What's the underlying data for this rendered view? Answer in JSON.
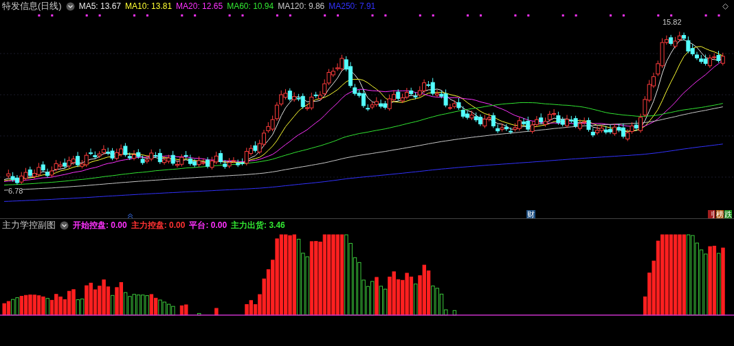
{
  "main_panel": {
    "title": "特发信息(日线)",
    "legend": [
      {
        "label": "MA5:",
        "value": "13.67",
        "color": "#e8e8e8"
      },
      {
        "label": "MA10:",
        "value": "13.81",
        "color": "#ffff32"
      },
      {
        "label": "MA20:",
        "value": "12.65",
        "color": "#ff32ff"
      },
      {
        "label": "MA60:",
        "value": "10.94",
        "color": "#32e632"
      },
      {
        "label": "MA120:",
        "value": "9.86",
        "color": "#c8c8c8"
      },
      {
        "label": "MA250:",
        "value": "7.91",
        "color": "#3232ff"
      }
    ],
    "high_label": "15.82",
    "low_label": "6.78",
    "markers": [
      {
        "text": "财",
        "color": "#1e4f82"
      }
    ],
    "badges": [
      {
        "text": "刂",
        "color": "#a01e1e"
      },
      {
        "text": "榜",
        "color": "#b4641e"
      },
      {
        "text": "跌",
        "color": "#1e8c1e"
      }
    ]
  },
  "sub_panel": {
    "title": "主力学控副图",
    "legend": [
      {
        "label": "开始控盘:",
        "value": "0.00",
        "color": "#ff32ff"
      },
      {
        "label": "主力控盘:",
        "value": "0.00",
        "color": "#ff3232"
      },
      {
        "label": "平台:",
        "value": "0.00",
        "color": "#ff32ff"
      },
      {
        "label": "主力出货:",
        "value": "3.46",
        "color": "#32e632"
      }
    ]
  }
}
